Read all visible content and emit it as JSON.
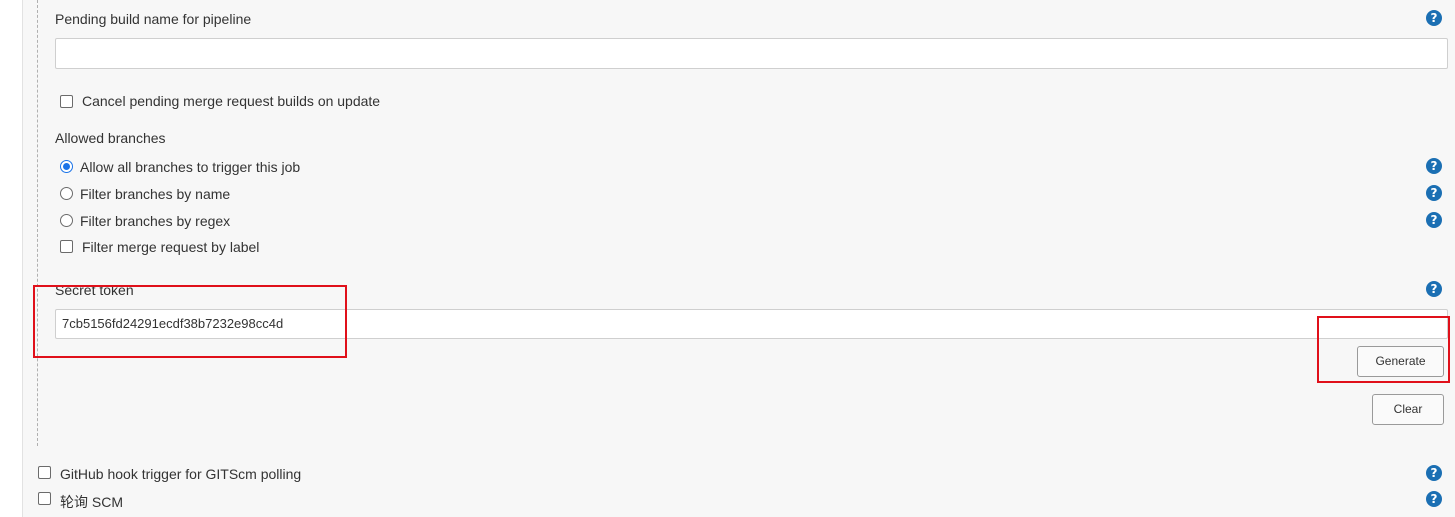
{
  "pending_build": {
    "label": "Pending build name for pipeline",
    "value": ""
  },
  "cancel_pending": {
    "label": "Cancel pending merge request builds on update",
    "checked": false
  },
  "allowed_branches": {
    "heading": "Allowed branches",
    "options": [
      {
        "label": "Allow all branches to trigger this job",
        "selected": true
      },
      {
        "label": "Filter branches by name",
        "selected": false
      },
      {
        "label": "Filter branches by regex",
        "selected": false
      }
    ],
    "filter_label": "Filter merge request by label"
  },
  "secret_token": {
    "label": "Secret token",
    "value": "7cb5156fd24291ecdf38b7232e98cc4d",
    "generate_label": "Generate",
    "clear_label": "Clear"
  },
  "triggers": [
    {
      "label": "GitHub hook trigger for GITScm polling",
      "checked": false
    },
    {
      "label": "轮询 SCM",
      "checked": false
    }
  ],
  "help_glyph": "?",
  "colors": {
    "help_icon": "#1b6fb3",
    "highlight": "#e0101a",
    "radio_selected": "#1a73e8"
  }
}
